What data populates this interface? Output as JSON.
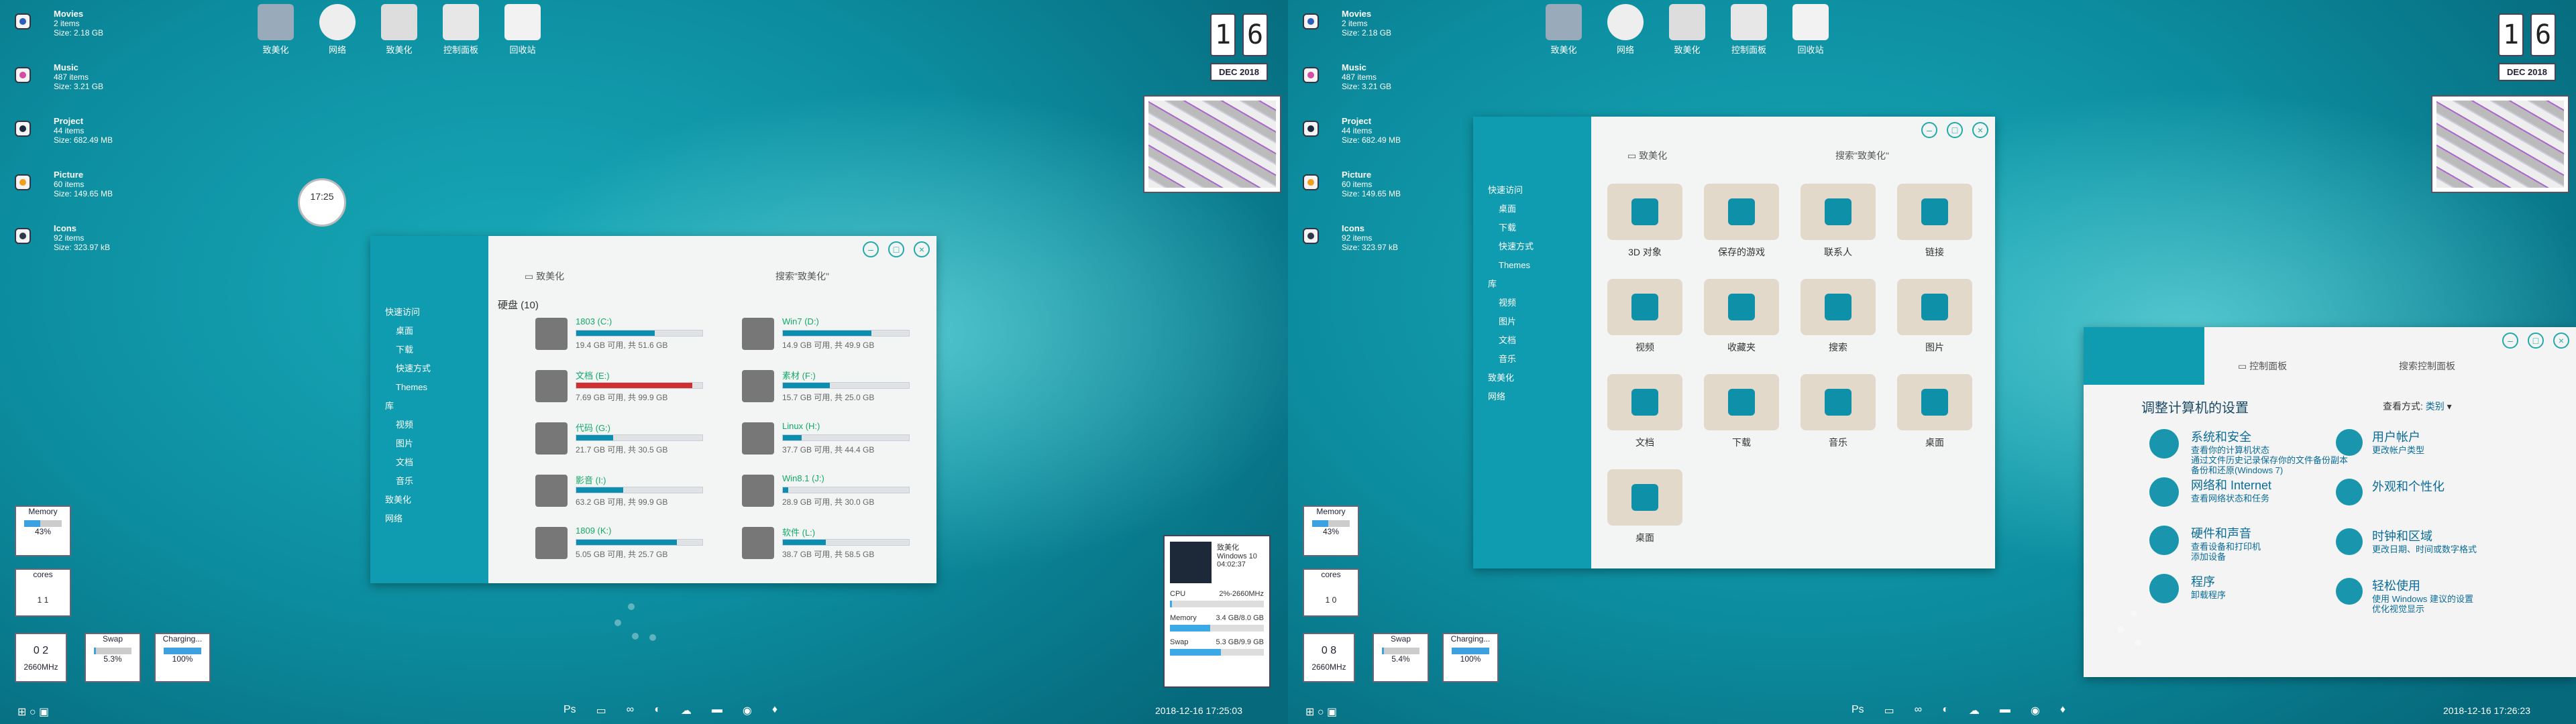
{
  "left": {
    "stats": [
      {
        "name": "Movies",
        "items": "2 items",
        "size": "Size: 2.18 GB",
        "color": "#2b5fbd"
      },
      {
        "name": "Music",
        "items": "487 items",
        "size": "Size: 3.21 GB",
        "color": "#d54ca1"
      },
      {
        "name": "Project",
        "items": "44 items",
        "size": "Size: 682.49 MB",
        "color": "#1b2a3a"
      },
      {
        "name": "Picture",
        "items": "60 items",
        "size": "Size: 149.65 MB",
        "color": "#f0a020"
      },
      {
        "name": "Icons",
        "items": "92 items",
        "size": "Size: 323.97 kB",
        "color": "#2f3845"
      }
    ],
    "desktop_icons": [
      "致美化",
      "网络",
      "致美化",
      "控制面板",
      "回收站"
    ],
    "calendar": {
      "d1": "1",
      "d2": "6",
      "month": "DEC 2018"
    },
    "clock_text": "17:25",
    "explorer": {
      "address": "致美化",
      "search": "搜索\"致美化\"",
      "nav": [
        "快速访问",
        "桌面",
        "下载",
        "快速方式",
        "Themes",
        "库",
        "视频",
        "图片",
        "文档",
        "音乐",
        "致美化",
        "网络"
      ],
      "section": "硬盘 (10)",
      "drives": [
        {
          "name": "1803 (C:)",
          "info": "19.4 GB 可用, 共 51.6 GB",
          "pct": 62,
          "red": false
        },
        {
          "name": "Win7 (D:)",
          "info": "14.9 GB 可用, 共 49.9 GB",
          "pct": 70,
          "red": false
        },
        {
          "name": "文档 (E:)",
          "info": "7.69 GB 可用, 共 99.9 GB",
          "pct": 92,
          "red": true
        },
        {
          "name": "素材 (F:)",
          "info": "15.7 GB 可用, 共 25.0 GB",
          "pct": 37,
          "red": false
        },
        {
          "name": "代码 (G:)",
          "info": "21.7 GB 可用, 共 30.5 GB",
          "pct": 29,
          "red": false
        },
        {
          "name": "Linux (H:)",
          "info": "37.7 GB 可用, 共 44.4 GB",
          "pct": 15,
          "red": false
        },
        {
          "name": "影音 (I:)",
          "info": "63.2 GB 可用, 共 99.9 GB",
          "pct": 37,
          "red": false
        },
        {
          "name": "Win8.1 (J:)",
          "info": "28.9 GB 可用, 共 30.0 GB",
          "pct": 4,
          "red": false
        },
        {
          "name": "1809 (K:)",
          "info": "5.05 GB 可用, 共 25.7 GB",
          "pct": 80,
          "red": false
        },
        {
          "name": "软件 (L:)",
          "info": "38.7 GB 可用, 共 58.5 GB",
          "pct": 34,
          "red": false
        }
      ]
    },
    "widgets": {
      "memory": "Memory",
      "memory_val": "43%",
      "memory_pct": 43,
      "cores": "cores",
      "cores_vals": "1   1",
      "cpu_digits": "0 2",
      "cpu_freq": "2660MHz",
      "swap": "Swap",
      "swap_val": "5.3%",
      "swap_pct": 5.3,
      "charging": "Charging...",
      "charging_val": "100%",
      "charging_pct": 100
    },
    "sysinfo": {
      "title": "致美化",
      "os": "Windows 10",
      "uptime": "04:02:37",
      "cpu": "CPU",
      "cpu_val": "2%-2660MHz",
      "cpu_pct": 2,
      "mem": "Memory",
      "mem_val": "3.4 GB/8.0 GB",
      "mem_pct": 43,
      "swap": "Swap",
      "swap_val": "5.3 GB/9.9 GB",
      "swap_pct": 54
    },
    "taskbar_time": "2018-12-16  17:25:03"
  },
  "right": {
    "stats": [
      {
        "name": "Movies",
        "items": "2 items",
        "size": "Size: 2.18 GB",
        "color": "#2b5fbd"
      },
      {
        "name": "Music",
        "items": "487 items",
        "size": "Size: 3.21 GB",
        "color": "#d54ca1"
      },
      {
        "name": "Project",
        "items": "44 items",
        "size": "Size: 682.49 MB",
        "color": "#1b2a3a"
      },
      {
        "name": "Picture",
        "items": "60 items",
        "size": "Size: 149.65 MB",
        "color": "#f0a020"
      },
      {
        "name": "Icons",
        "items": "92 items",
        "size": "Size: 323.97 kB",
        "color": "#2f3845"
      }
    ],
    "desktop_icons": [
      "致美化",
      "网络",
      "致美化",
      "控制面板",
      "回收站"
    ],
    "calendar": {
      "d1": "1",
      "d2": "6",
      "month": "DEC 2018"
    },
    "explorer": {
      "address": "致美化",
      "search": "搜索\"致美化\"",
      "nav": [
        "快速访问",
        "桌面",
        "下载",
        "快速方式",
        "Themes",
        "库",
        "视频",
        "图片",
        "文档",
        "音乐",
        "致美化",
        "网络"
      ],
      "tiles": [
        "3D 对象",
        "保存的游戏",
        "联系人",
        "链接",
        "视频",
        "收藏夹",
        "搜索",
        "图片",
        "文档",
        "下载",
        "音乐",
        "桌面",
        "桌面"
      ]
    },
    "control_panel": {
      "address": "控制面板",
      "search": "搜索控制面板",
      "heading": "调整计算机的设置",
      "view_label": "查看方式:",
      "view_value": "类别",
      "left_items": [
        {
          "title": "系统和安全",
          "sub": "查看你的计算机状态\n通过文件历史记录保存你的文件备份副本\n备份和还原(Windows 7)"
        },
        {
          "title": "网络和 Internet",
          "sub": "查看网络状态和任务"
        },
        {
          "title": "硬件和声音",
          "sub": "查看设备和打印机\n添加设备"
        },
        {
          "title": "程序",
          "sub": "卸载程序"
        }
      ],
      "right_items": [
        {
          "title": "用户帐户",
          "sub": "更改帐户类型"
        },
        {
          "title": "外观和个性化",
          "sub": ""
        },
        {
          "title": "时钟和区域",
          "sub": "更改日期、时间或数字格式"
        },
        {
          "title": "轻松使用",
          "sub": "使用 Windows 建议的设置\n优化视觉显示"
        }
      ]
    },
    "widgets": {
      "memory": "Memory",
      "memory_val": "43%",
      "memory_pct": 43,
      "cores": "cores",
      "cores_vals": "1   0",
      "cpu_digits": "0 8",
      "cpu_freq": "2660MHz",
      "swap": "Swap",
      "swap_val": "5.4%",
      "swap_pct": 5.4,
      "charging": "Charging...",
      "charging_val": "100%",
      "charging_pct": 100
    },
    "taskbar_time": "2018-12-16  17:26:23"
  },
  "colors": {
    "accent": "#0f9bb0",
    "desktop": "#0a8fa3",
    "bar": "#0a8fb0",
    "warn": "#d23030"
  }
}
